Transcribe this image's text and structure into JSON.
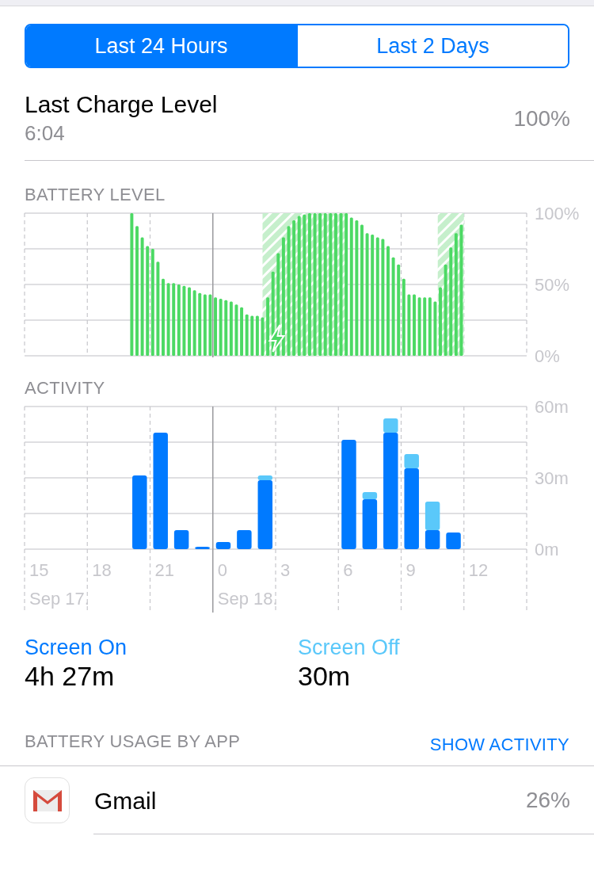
{
  "segments": [
    {
      "label": "Last 24 Hours",
      "selected": true
    },
    {
      "label": "Last 2 Days",
      "selected": false
    }
  ],
  "last_charge": {
    "label": "Last Charge Level",
    "time": "6:04",
    "value": "100%"
  },
  "battery_chart": {
    "chart_data": {
      "type": "bar",
      "title": "BATTERY LEVEL",
      "ylim": [
        0,
        100
      ],
      "yticks": [
        {
          "value": 0,
          "label": "0%"
        },
        {
          "value": 50,
          "label": "50%"
        },
        {
          "value": 100,
          "label": "100%"
        }
      ],
      "values": [
        null,
        null,
        null,
        null,
        null,
        null,
        null,
        null,
        null,
        null,
        null,
        null,
        null,
        null,
        null,
        null,
        null,
        null,
        null,
        null,
        100,
        91,
        83,
        77,
        75,
        66,
        54,
        51,
        51,
        50,
        49,
        48,
        46,
        44,
        43,
        43,
        41,
        40,
        39,
        38,
        36,
        34,
        29,
        28,
        28,
        27,
        41,
        59,
        72,
        83,
        91,
        95,
        98,
        99,
        100,
        100,
        100,
        100,
        100,
        100,
        100,
        100,
        97,
        95,
        92,
        86,
        85,
        83,
        82,
        77,
        69,
        64,
        54,
        43,
        43,
        41,
        41,
        41,
        38,
        48,
        64,
        76,
        86,
        92,
        null,
        null,
        null,
        null,
        null,
        null,
        null,
        null,
        null,
        null,
        null,
        null
      ]
    }
  },
  "activity_chart": {
    "chart_data": {
      "type": "bar",
      "title": "ACTIVITY",
      "stacked": true,
      "ylim": [
        0,
        60
      ],
      "yticks": [
        {
          "value": 0,
          "label": "0m"
        },
        {
          "value": 30,
          "label": "30m"
        },
        {
          "value": 60,
          "label": "60m"
        }
      ],
      "series": [
        {
          "name": "Screen On",
          "color": "#007aff",
          "values": [
            0,
            0,
            0,
            0,
            0,
            31,
            49,
            8,
            1,
            3,
            8,
            29,
            0,
            0,
            0,
            46,
            21,
            49,
            34,
            8,
            7,
            0,
            0,
            0
          ]
        },
        {
          "name": "Screen Off",
          "color": "#5ac8fa",
          "values": [
            0,
            0,
            0,
            0,
            0,
            0,
            0,
            0,
            0,
            0,
            0,
            2,
            0,
            0,
            0,
            0,
            3,
            6,
            6,
            12,
            0,
            0,
            0,
            0
          ]
        }
      ],
      "annotations": [
        "Sep 17.",
        "Sep 18."
      ]
    },
    "hour_labels": [
      "15",
      "18",
      "21",
      "0",
      "3",
      "6",
      "9",
      "12"
    ]
  },
  "screen_time": [
    {
      "value": "4h 27m"
    },
    {
      "value": "30m"
    }
  ],
  "usage": {
    "title": "BATTERY USAGE BY APP",
    "action": "SHOW ACTIVITY"
  },
  "apps": [
    {
      "name": "Gmail",
      "share": "26%"
    }
  ]
}
